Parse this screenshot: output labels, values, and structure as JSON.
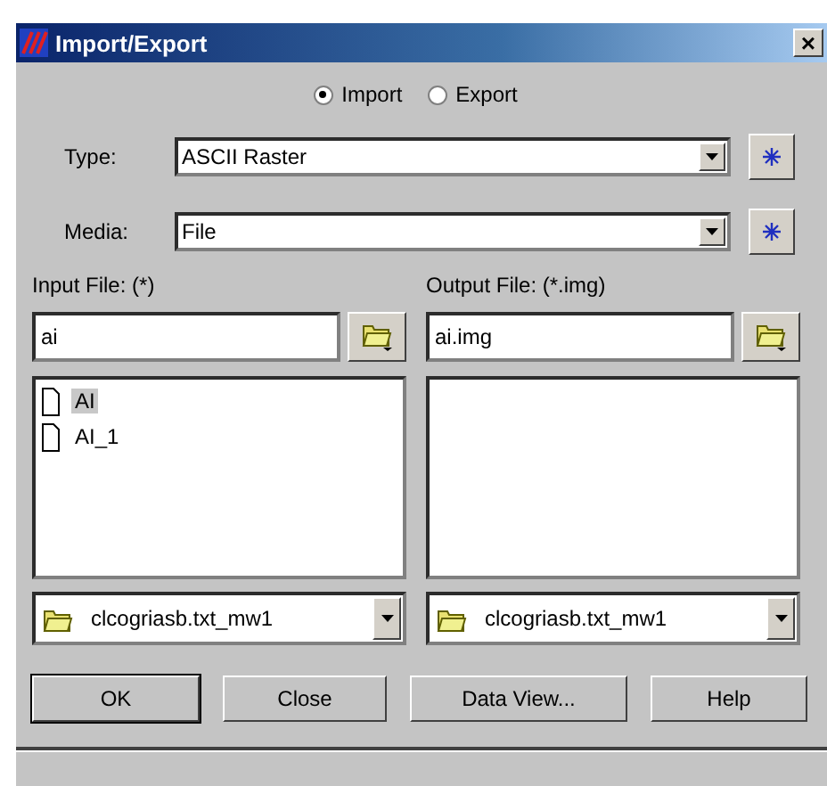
{
  "window": {
    "title": "Import/Export",
    "close": "×"
  },
  "mode": [
    {
      "label": "Import",
      "selected": true
    },
    {
      "label": "Export",
      "selected": false
    }
  ],
  "type": {
    "label": "Type:",
    "value": "ASCII Raster"
  },
  "media": {
    "label": "Media:",
    "value": "File"
  },
  "input": {
    "label": "Input File: (*)",
    "value": "ai",
    "files": [
      {
        "name": "AI",
        "selected": true
      },
      {
        "name": "AI_1",
        "selected": false
      }
    ],
    "folder": "clcogriasb.txt_mw1"
  },
  "output": {
    "label": "Output File: (*.img)",
    "value": "ai.img",
    "folder": "clcogriasb.txt_mw1"
  },
  "buttons": [
    "OK",
    "Close",
    "Data View...",
    "Help"
  ]
}
